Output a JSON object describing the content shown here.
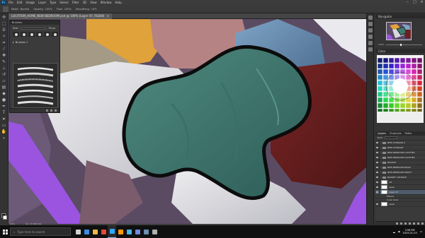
{
  "menu": {
    "logo": "Ps",
    "items": [
      "File",
      "Edit",
      "Image",
      "Layer",
      "Type",
      "Select",
      "Filter",
      "3D",
      "View",
      "Window",
      "Help"
    ]
  },
  "options": {
    "mode_label": "Mode:",
    "mode_value": "Normal",
    "opacity_label": "Opacity:",
    "opacity_value": "100%",
    "flow_label": "Flow:",
    "flow_value": "100%",
    "smoothing_label": "Smoothing:",
    "smoothing_value": "10%"
  },
  "document": {
    "tab_title": "LOCATION_HOME_NEW BEDROOM.psd @ 100% (Layer 47, RGB/8)"
  },
  "brush_panel": {
    "title": "Brushes",
    "size_label": "Size:",
    "size_value": "30 px",
    "group_label": "Brushes 1"
  },
  "right_panels": {
    "navigator_title": "Navigator",
    "color_title": "Color",
    "zoom_value": "100%"
  },
  "layers_panel": {
    "tabs": [
      "Layers",
      "Channels",
      "Paths"
    ],
    "filter_label": "Kind",
    "rows": [
      {
        "name": "NEW STORAGE 2",
        "type": "folder"
      },
      {
        "name": "NEW STORAGE",
        "type": "folder"
      },
      {
        "name": "NEW BEDROOM CLOTHES",
        "type": "folder"
      },
      {
        "name": "NEW BEDROOM CLOTHES",
        "type": "folder"
      },
      {
        "name": "BACKUP",
        "type": "folder"
      },
      {
        "name": "NEW BEDROOM BACK",
        "type": "folder"
      },
      {
        "name": "NEW BEDROOM NIGHT",
        "type": "folder"
      },
      {
        "name": "BASKET CLEANUP",
        "type": "folder"
      },
      {
        "name": "ref",
        "type": "layer"
      },
      {
        "name": "Layer",
        "type": "layer"
      },
      {
        "name": "Layer 47",
        "type": "layer",
        "selected": true
      },
      {
        "name": "Effects",
        "type": "sub"
      },
      {
        "name": "Inner Glow",
        "type": "sub"
      },
      {
        "name": "Layer",
        "type": "layer"
      }
    ]
  },
  "status": {
    "zoom": "100%",
    "doc": "Doc: 30.7M/1.64G"
  },
  "taskbar": {
    "search_placeholder": "Type here to search",
    "time": "3:56 PM",
    "date": "2019-01-03",
    "apps": [
      {
        "name": "task-view",
        "color": "#cfcfcf"
      },
      {
        "name": "edge",
        "color": "#3a8ee6"
      },
      {
        "name": "folder",
        "color": "#e8b84a"
      },
      {
        "name": "chrome",
        "color": "#e24a3b"
      },
      {
        "name": "photoshop",
        "color": "#31a8ff"
      },
      {
        "name": "illustrator",
        "color": "#ff9a00"
      },
      {
        "name": "paint",
        "color": "#46b4e6"
      },
      {
        "name": "discord",
        "color": "#7289da"
      },
      {
        "name": "steam",
        "color": "#6b8fb3"
      },
      {
        "name": "obs",
        "color": "#b0b0b0"
      }
    ]
  },
  "colors": {
    "ui_dark": "#2a2a2a",
    "accent": "#31a8ff",
    "selection": "#4e5b6b"
  }
}
